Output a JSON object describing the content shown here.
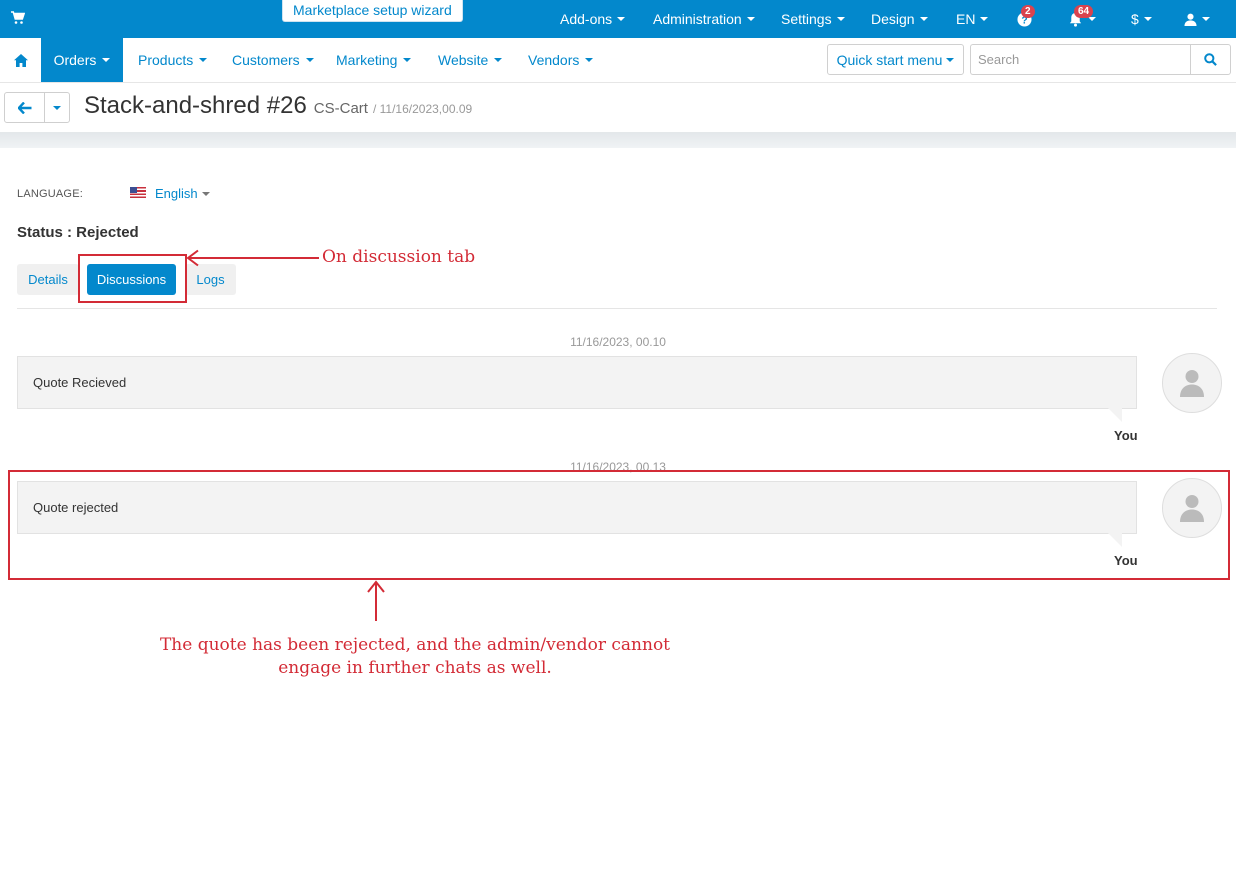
{
  "topbar": {
    "wizard_label": "Marketplace setup wizard",
    "menu": [
      {
        "label": "Add-ons"
      },
      {
        "label": "Administration"
      },
      {
        "label": "Settings"
      },
      {
        "label": "Design"
      },
      {
        "label": "EN"
      }
    ],
    "help_badge": "2",
    "notifications_badge": "64",
    "currency_label": "$"
  },
  "mainnav": {
    "orders_label": "Orders",
    "items": [
      {
        "label": "Products"
      },
      {
        "label": "Customers"
      },
      {
        "label": "Marketing"
      },
      {
        "label": "Website"
      },
      {
        "label": "Vendors"
      }
    ],
    "quick_start_label": "Quick start menu",
    "search_placeholder": "Search"
  },
  "page": {
    "title": "Stack-and-shred #26",
    "subtitle": "CS-Cart",
    "date": "/ 11/16/2023,00.09"
  },
  "content": {
    "language_label": "LANGUAGE:",
    "language_value": "English",
    "status_text": "Status : Rejected",
    "tabs": [
      {
        "label": "Details"
      },
      {
        "label": "Discussions"
      },
      {
        "label": "Logs"
      }
    ],
    "messages": [
      {
        "date": "11/16/2023, 00.10",
        "text": "Quote Recieved",
        "author": "You"
      },
      {
        "date": "11/16/2023, 00.13",
        "text": "Quote rejected",
        "author": "You"
      }
    ]
  },
  "annotations": {
    "tab_note": "On discussion tab",
    "message_note": "The quote has been rejected, and the admin/vendor cannot engage in further chats as well."
  },
  "colors": {
    "primary": "#0388cc",
    "annotation": "#d32b36",
    "badge": "#d9434e"
  }
}
